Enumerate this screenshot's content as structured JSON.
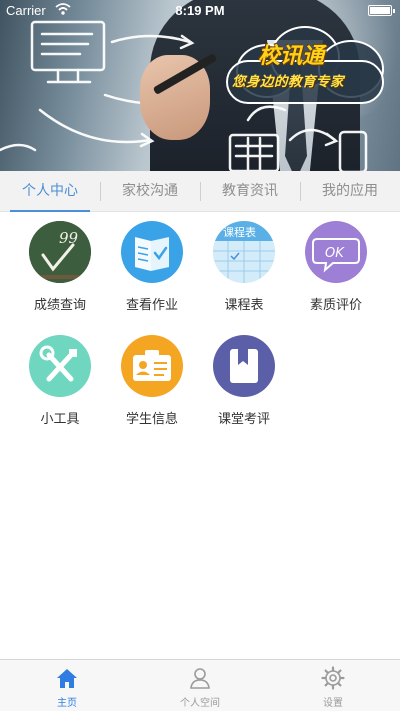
{
  "status_bar": {
    "carrier": "Carrier",
    "time": "8:19 PM"
  },
  "banner": {
    "logo_title": "校讯通",
    "logo_subtitle": "您身边的教育专家"
  },
  "tabs": [
    {
      "label": "个人中心",
      "active": true
    },
    {
      "label": "家校沟通",
      "active": false
    },
    {
      "label": "教育资讯",
      "active": false
    },
    {
      "label": "我的应用",
      "active": false
    }
  ],
  "apps": [
    {
      "label": "成绩查询",
      "icon": "chalkboard-icon",
      "color": "#3d5d3f",
      "chalk_text": "99"
    },
    {
      "label": "查看作业",
      "icon": "homework-book-icon",
      "color": "#3aa3e8"
    },
    {
      "label": "课程表",
      "icon": "timetable-icon",
      "color": "#bfe1f6",
      "sheet_text": "课程表"
    },
    {
      "label": "素质评价",
      "icon": "ok-speech-bubble-icon",
      "color": "#9d7fd6",
      "bubble_text": "OK"
    },
    {
      "label": "小工具",
      "icon": "tools-icon",
      "color": "#6fd6c0"
    },
    {
      "label": "学生信息",
      "icon": "id-card-icon",
      "color": "#f4a623"
    },
    {
      "label": "课堂考评",
      "icon": "bookmark-icon",
      "color": "#5b5fa8"
    }
  ],
  "tab_bar": [
    {
      "label": "主页",
      "icon": "home-icon",
      "active": true
    },
    {
      "label": "个人空间",
      "icon": "person-icon",
      "active": false
    },
    {
      "label": "设置",
      "icon": "gear-icon",
      "active": false
    }
  ],
  "colors": {
    "accent": "#4a8fd8",
    "tabbar_active": "#2f7de1",
    "text": "#333333",
    "muted": "#8e8e8e"
  }
}
